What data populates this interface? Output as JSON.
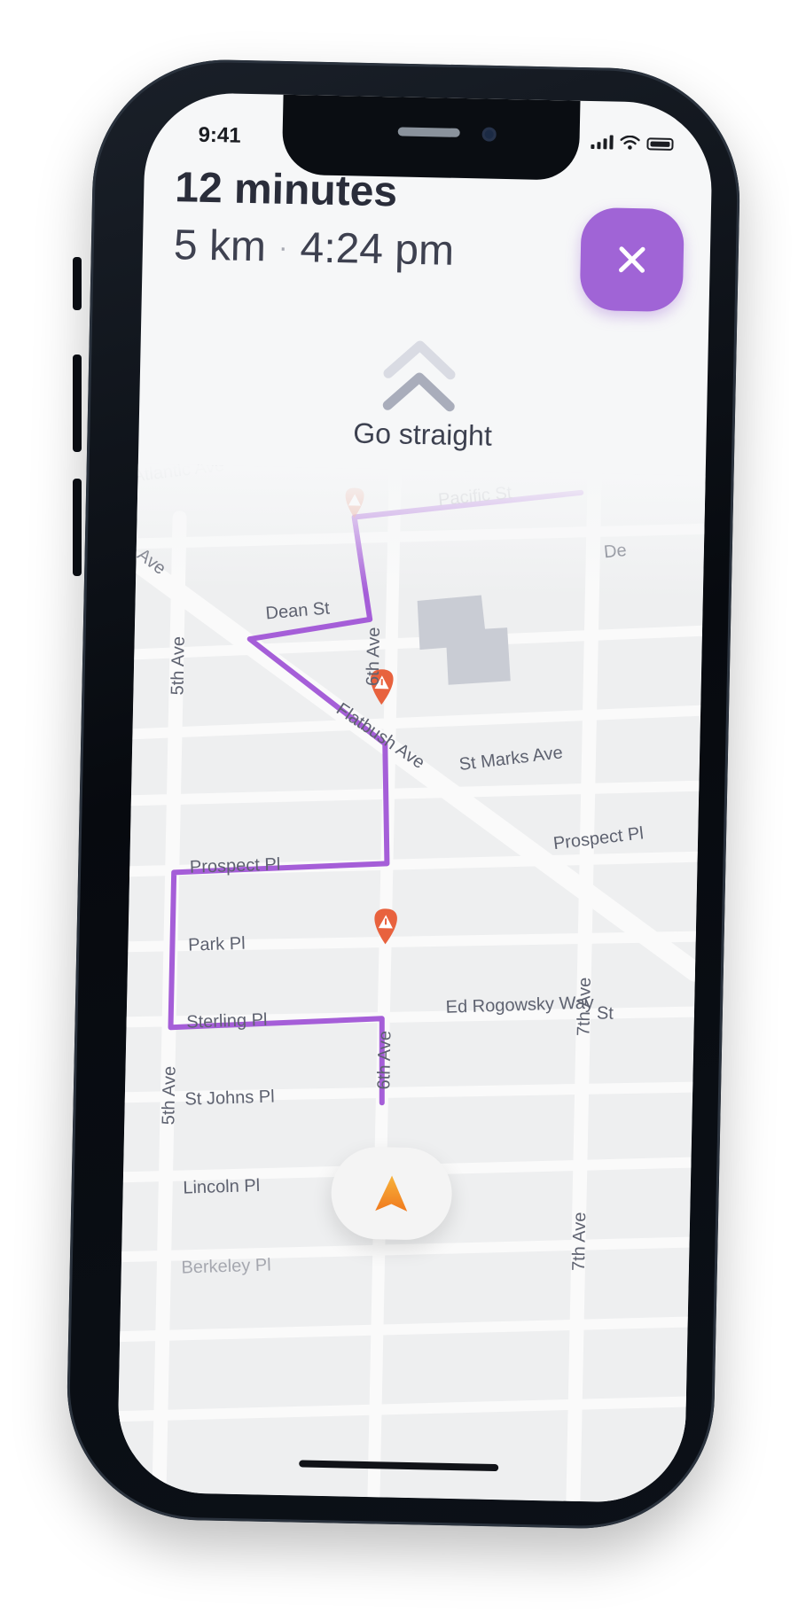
{
  "status_bar": {
    "time": "9:41"
  },
  "trip": {
    "duration": "12 minutes",
    "distance": "5 km",
    "separator": "·",
    "arrival": "4:24 pm"
  },
  "instruction": {
    "text": "Go straight",
    "icon": "double-chevron-up-icon"
  },
  "close_button": {
    "icon": "close-icon",
    "color": "#a064d6"
  },
  "map": {
    "route_color": "#a55ed8",
    "streets": {
      "atlantic": "Atlantic Ave",
      "pacific": "Pacific St",
      "dean": "Dean St",
      "sixth_top": "6th Ave",
      "flatbush": "Flatbush Ave",
      "st_marks": "St Marks Ave",
      "prospect_right": "Prospect Pl",
      "prospect": "Prospect Pl",
      "park": "Park Pl",
      "ed_rogowsky": "Ed Rogowsky Way",
      "seventh": "7th Ave",
      "sterling": "Sterling Pl",
      "fifth_top": "5th Ave",
      "fifth_bottom": "5th Ave",
      "st_johns": "St Johns Pl",
      "sixth_bottom": "6th Ave",
      "lincoln": "Lincoln Pl",
      "berkeley": "Berkeley Pl",
      "seventh_bottom": "7th Ave",
      "right_st": "St",
      "right_de": "De",
      "ave_left": "Ave"
    },
    "hazard_icon": "warning-pin-icon",
    "hazard_color": "#e8623e"
  },
  "locate_button": {
    "icon": "navigation-arrow-icon",
    "color": "#f59a2a"
  }
}
